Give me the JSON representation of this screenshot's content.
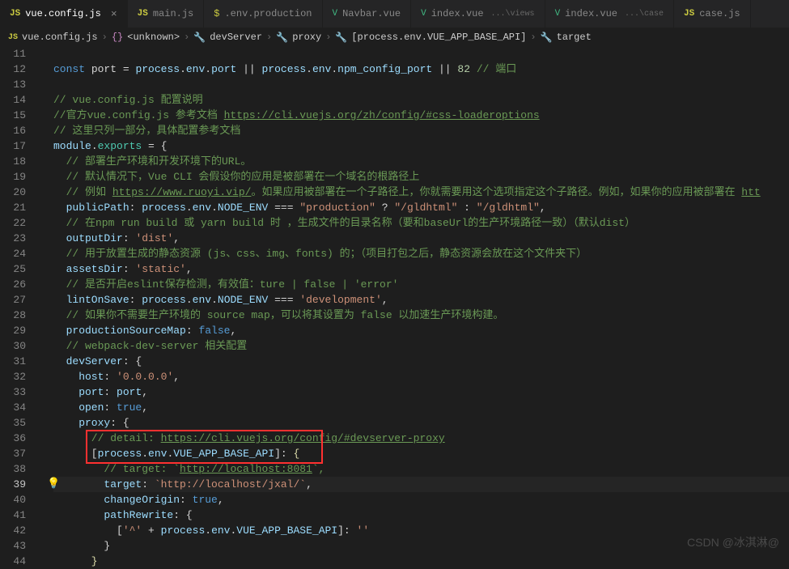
{
  "tabs": [
    {
      "icon": "JS",
      "label": "vue.config.js",
      "active": true,
      "close": "×"
    },
    {
      "icon": "JS",
      "label": "main.js"
    },
    {
      "icon": "$",
      "label": ".env.production"
    },
    {
      "icon": "V",
      "label": "Navbar.vue"
    },
    {
      "icon": "V",
      "label": "index.vue",
      "dim": "...\\views"
    },
    {
      "icon": "V",
      "label": "index.vue",
      "dim": "...\\case"
    },
    {
      "icon": "JS",
      "label": "case.js"
    }
  ],
  "breadcrumb": [
    {
      "icon": "JS",
      "text": "vue.config.js"
    },
    {
      "icon": "{}",
      "text": "<unknown>"
    },
    {
      "icon": "🔧",
      "text": "devServer"
    },
    {
      "icon": "🔧",
      "text": "proxy"
    },
    {
      "icon": "🔧",
      "text": "[process.env.VUE_APP_BASE_API]"
    },
    {
      "icon": "🔧",
      "text": "target"
    }
  ],
  "lineStart": 11,
  "currentLine": 39,
  "code": {
    "l11": "",
    "l12": {
      "a": "const",
      "b": " port ",
      "c": "=",
      "d": " process",
      "e": ".",
      "f": "env",
      "g": ".",
      "h": "port ",
      "i": "||",
      "j": " process",
      "k": ".",
      "l": "env",
      "m": ".",
      "n": "npm_config_port ",
      "o": "||",
      "p": " ",
      "q": "82",
      "r": " // 端口"
    },
    "l13": "",
    "l14": "// vue.config.js 配置说明",
    "l15a": "//官方vue.config.js 参考文档 ",
    "l15b": "https://cli.vuejs.org/zh/config/#css-loaderoptions",
    "l16": "// 这里只列一部分，具体配置参考文档",
    "l17a": "module",
    "l17b": ".",
    "l17c": "exports",
    "l17d": " = {",
    "l18": "  // 部署生产环境和开发环境下的URL。",
    "l19": "  // 默认情况下，Vue CLI 会假设你的应用是被部署在一个域名的根路径上",
    "l20a": "  // 例如 ",
    "l20b": "https://www.ruoyi.vip/",
    "l20c": "。如果应用被部署在一个子路径上，你就需要用这个选项指定这个子路径。例如，如果你的应用被部署在 ",
    "l20d": "htt",
    "l21a": "  publicPath",
    "l21b": ":",
    "l21c": " process",
    "l21d": ".",
    "l21e": "env",
    "l21f": ".",
    "l21g": "NODE_ENV",
    "l21h": " === ",
    "l21i": "\"production\"",
    "l21j": " ? ",
    "l21k": "\"/gldhtml\"",
    "l21l": " : ",
    "l21m": "\"/gldhtml\"",
    "l21n": ",",
    "l22": "  // 在npm run build 或 yarn build 时 ，生成文件的目录名称（要和baseUrl的生产环境路径一致）（默认dist）",
    "l23a": "  outputDir",
    "l23b": ": ",
    "l23c": "'dist'",
    "l23d": ",",
    "l24": "  // 用于放置生成的静态资源 (js、css、img、fonts) 的；（项目打包之后，静态资源会放在这个文件夹下）",
    "l25a": "  assetsDir",
    "l25b": ": ",
    "l25c": "'static'",
    "l25d": ",",
    "l26": "  // 是否开启eslint保存检测，有效值：ture | false | 'error'",
    "l27a": "  lintOnSave",
    "l27b": ":",
    "l27c": " process",
    "l27d": ".",
    "l27e": "env",
    "l27f": ".",
    "l27g": "NODE_ENV",
    "l27h": " === ",
    "l27i": "'development'",
    "l27j": ",",
    "l28": "  // 如果你不需要生产环境的 source map，可以将其设置为 false 以加速生产环境构建。",
    "l29a": "  productionSourceMap",
    "l29b": ": ",
    "l29c": "false",
    "l29d": ",",
    "l30": "  // webpack-dev-server 相关配置",
    "l31a": "  devServer",
    "l31b": ": {",
    "l32a": "    host",
    "l32b": ": ",
    "l32c": "'0.0.0.0'",
    "l32d": ",",
    "l33a": "    port",
    "l33b": ":",
    "l33c": " port",
    "l33d": ",",
    "l34a": "    open",
    "l34b": ": ",
    "l34c": "true",
    "l34d": ",",
    "l35a": "    proxy",
    "l35b": ": {",
    "l36a": "      // detail: ",
    "l36b": "https://cli.vuejs.org/config/#devserver-proxy",
    "l37a": "      [",
    "l37b": "process",
    "l37c": ".",
    "l37d": "env",
    "l37e": ".",
    "l37f": "VUE_APP_BASE_API",
    "l37g": "]: ",
    "l37h": "{",
    "l38a": "        // target: `",
    "l38b": "http://localhost:8081",
    "l38c": "`,",
    "l39a": "        target",
    "l39b": ": ",
    "l39c": "`http://localhost/jxal/`",
    "l39d": ",",
    "l40a": "        changeOrigin",
    "l40b": ": ",
    "l40c": "true",
    "l40d": ",",
    "l41a": "        pathRewrite",
    "l41b": ": {",
    "l42a": "          [",
    "l42b": "'^'",
    "l42c": " + ",
    "l42d": "process",
    "l42e": ".",
    "l42f": "env",
    "l42g": ".",
    "l42h": "VUE_APP_BASE_API",
    "l42i": "]: ",
    "l42j": "''",
    "l43": "        }",
    "l44": "      }"
  },
  "watermark": "CSDN @冰淇淋@"
}
